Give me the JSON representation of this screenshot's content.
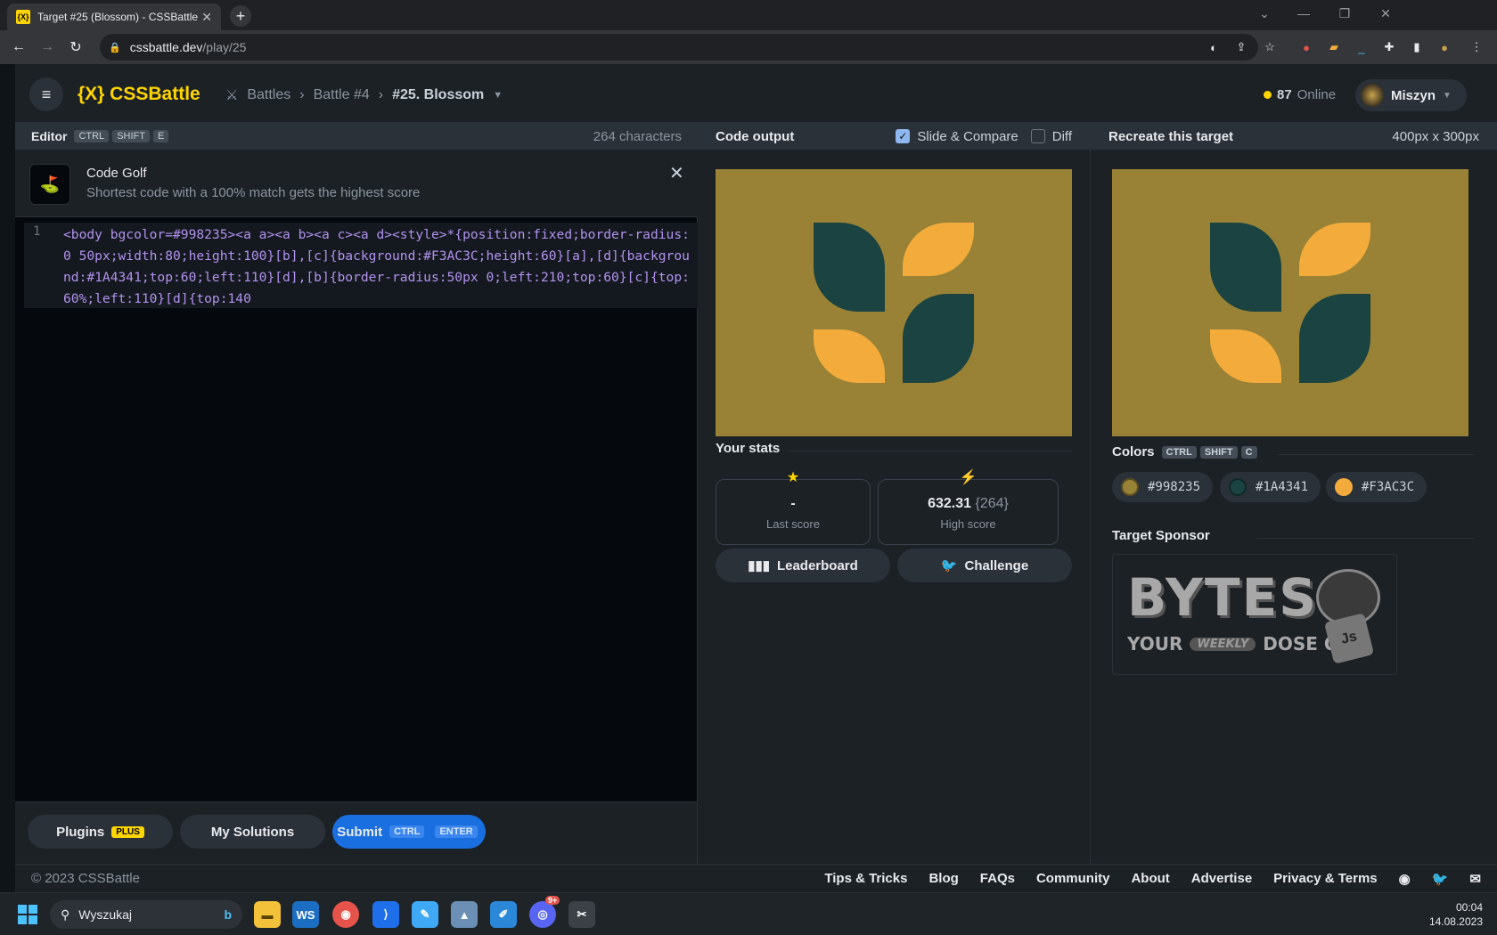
{
  "browser": {
    "tab_title": "Target #25 (Blossom) - CSSBattle",
    "url_host": "cssbattle.dev",
    "url_path": "/play/25"
  },
  "header": {
    "logo": "{X} CSSBattle",
    "crumbs": [
      "Battles",
      "Battle #4",
      "#25. Blossom"
    ],
    "online_count": "87",
    "online_label": "Online",
    "username": "Miszyn"
  },
  "editor": {
    "label": "Editor",
    "shortcut": [
      "CTRL",
      "SHIFT",
      "E"
    ],
    "char_count": "264 characters",
    "tip_title": "Code Golf",
    "tip_text": "Shortest code with a 100% match gets the highest score",
    "line_number": "1",
    "code": "<body bgcolor=#998235><a a><a b><a c><a d><style>*{position:fixed;border-radius:0 50px;width:80;height:100}[b],[c]{background:#F3AC3C;height:60}[a],[d]{background:#1A4341;top:60;left:110}[d],[b]{border-radius:50px 0;left:210;top:60}[c]{top:60%;left:110}[d]{top:140"
  },
  "buttons": {
    "plugins": "Plugins",
    "plugins_tag": "PLUS",
    "my_solutions": "My Solutions",
    "submit": "Submit",
    "submit_keys": [
      "CTRL",
      "ENTER"
    ],
    "leaderboard": "Leaderboard",
    "challenge": "Challenge"
  },
  "output": {
    "label": "Code output",
    "slide_compare": "Slide & Compare",
    "slide_compare_checked": true,
    "diff": "Diff",
    "diff_checked": false
  },
  "stats": {
    "title": "Your stats",
    "last_score": "-",
    "last_score_label": "Last score",
    "high_score": "632.31",
    "high_score_chars": "{264}",
    "high_score_label": "High score"
  },
  "target": {
    "label": "Recreate this target",
    "size": "400px x 300px",
    "colors_title": "Colors",
    "colors_shortcut": [
      "CTRL",
      "SHIFT",
      "C"
    ],
    "colors": [
      "#998235",
      "#1A4341",
      "#F3AC3C"
    ],
    "sponsor_title": "Target Sponsor",
    "sponsor_big": "BYTES",
    "sponsor_your": "YOUR",
    "sponsor_weekly": "WEEKLY",
    "sponsor_dose": "DOSE OF",
    "sponsor_js": "Js"
  },
  "footer": {
    "copyright": "© 2023 CSSBattle",
    "links": [
      "Tips & Tricks",
      "Blog",
      "FAQs",
      "Community",
      "About",
      "Advertise",
      "Privacy & Terms"
    ]
  },
  "taskbar": {
    "search_placeholder": "Wyszukaj",
    "time": "00:04",
    "date": "14.08.2023",
    "discord_badge": "9+"
  },
  "colors": {
    "background": "#998235",
    "dark_leaf": "#1A4341",
    "light_leaf": "#F3AC3C",
    "brand": "#ffd500",
    "submit": "#1a6fe0"
  }
}
